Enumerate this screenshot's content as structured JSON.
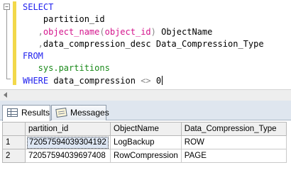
{
  "editor": {
    "fold_symbol": "−",
    "lines": [
      {
        "parts": [
          {
            "t": "SELECT",
            "c": "kw"
          }
        ]
      },
      {
        "parts": [
          {
            "t": "    partition_id",
            "c": "ident"
          }
        ]
      },
      {
        "parts": [
          {
            "t": "   ,",
            "c": "gray"
          },
          {
            "t": "object_name",
            "c": "fn"
          },
          {
            "t": "(",
            "c": "gray"
          },
          {
            "t": "object_id",
            "c": "fn"
          },
          {
            "t": ") ",
            "c": "gray"
          },
          {
            "t": "ObjectName",
            "c": "ident"
          }
        ]
      },
      {
        "parts": [
          {
            "t": "   ,",
            "c": "gray"
          },
          {
            "t": "data_compression_desc Data_Compression_Type",
            "c": "ident"
          }
        ]
      },
      {
        "parts": [
          {
            "t": "FROM",
            "c": "kw"
          }
        ]
      },
      {
        "parts": [
          {
            "t": "   sys.partitions",
            "c": "sys"
          }
        ]
      },
      {
        "parts": [
          {
            "t": "WHERE ",
            "c": "kw"
          },
          {
            "t": "data_compression ",
            "c": "ident"
          },
          {
            "t": "<>",
            "c": "gray"
          },
          {
            "t": " 0",
            "c": "ident"
          }
        ],
        "caret": true
      }
    ]
  },
  "tabs": {
    "results_label": "Results",
    "messages_label": "Messages"
  },
  "grid": {
    "columns": [
      "partition_id",
      "ObjectName",
      "Data_Compression_Type"
    ],
    "rows": [
      {
        "num": "1",
        "partition_id": "72057594039304192",
        "object_name": "LogBackup",
        "compression_type": "ROW"
      },
      {
        "num": "2",
        "partition_id": "72057594039697408",
        "object_name": "RowCompression",
        "compression_type": "PAGE"
      }
    ]
  },
  "colors": {
    "keyword": "#2222ee",
    "function": "#d4148c",
    "system_object": "#1a8a1a",
    "change_marker": "#f2d84a"
  },
  "icons": {
    "results_tab": "grid-icon",
    "messages_tab": "message-icon"
  }
}
